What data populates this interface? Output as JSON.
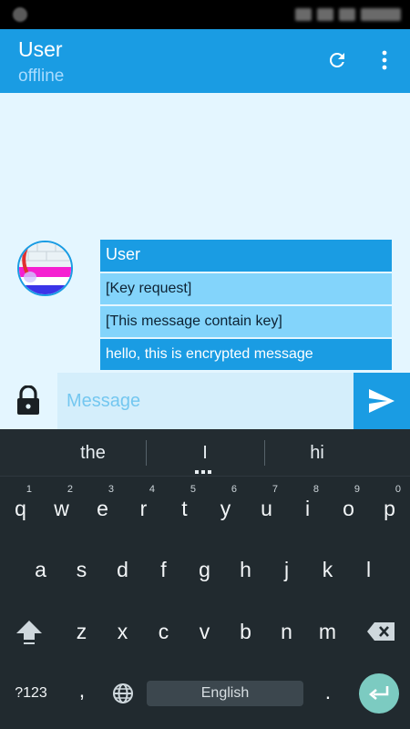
{
  "app_bar": {
    "title": "User",
    "subtitle": "offline",
    "refresh_icon": "refresh-icon",
    "menu_icon": "overflow-menu-icon"
  },
  "colors": {
    "primary": "#1a9ce3",
    "bubble_light": "#83d4fb",
    "chat_background": "#e4f6ff",
    "keyboard_background": "#212a2f",
    "enter_key": "#7ccbc1"
  },
  "chat": {
    "sender": "User",
    "messages": [
      {
        "text": "[Key request]"
      },
      {
        "text": "[This message contain key]"
      },
      {
        "text": "hello, this is encrypted message"
      }
    ]
  },
  "composer": {
    "placeholder": "Message",
    "value": "",
    "lock_icon": "lock-icon",
    "send_icon": "send-icon"
  },
  "keyboard": {
    "suggestions": [
      "the",
      "I",
      "hi"
    ],
    "rows": [
      [
        {
          "label": "q",
          "hint": "1"
        },
        {
          "label": "w",
          "hint": "2"
        },
        {
          "label": "e",
          "hint": "3"
        },
        {
          "label": "r",
          "hint": "4"
        },
        {
          "label": "t",
          "hint": "5"
        },
        {
          "label": "y",
          "hint": "6"
        },
        {
          "label": "u",
          "hint": "7"
        },
        {
          "label": "i",
          "hint": "8"
        },
        {
          "label": "o",
          "hint": "9"
        },
        {
          "label": "p",
          "hint": "0"
        }
      ],
      [
        {
          "label": "a"
        },
        {
          "label": "s"
        },
        {
          "label": "d"
        },
        {
          "label": "f"
        },
        {
          "label": "g"
        },
        {
          "label": "h"
        },
        {
          "label": "j"
        },
        {
          "label": "k"
        },
        {
          "label": "l"
        }
      ],
      [
        {
          "label": "z"
        },
        {
          "label": "x"
        },
        {
          "label": "c"
        },
        {
          "label": "v"
        },
        {
          "label": "b"
        },
        {
          "label": "n"
        },
        {
          "label": "m"
        }
      ]
    ],
    "symbols_label": "?123",
    "comma_label": ",",
    "period_label": ".",
    "space_label": "English",
    "shift_icon": "shift-icon",
    "delete_icon": "backspace-icon",
    "globe_icon": "globe-icon",
    "enter_icon": "enter-icon"
  }
}
